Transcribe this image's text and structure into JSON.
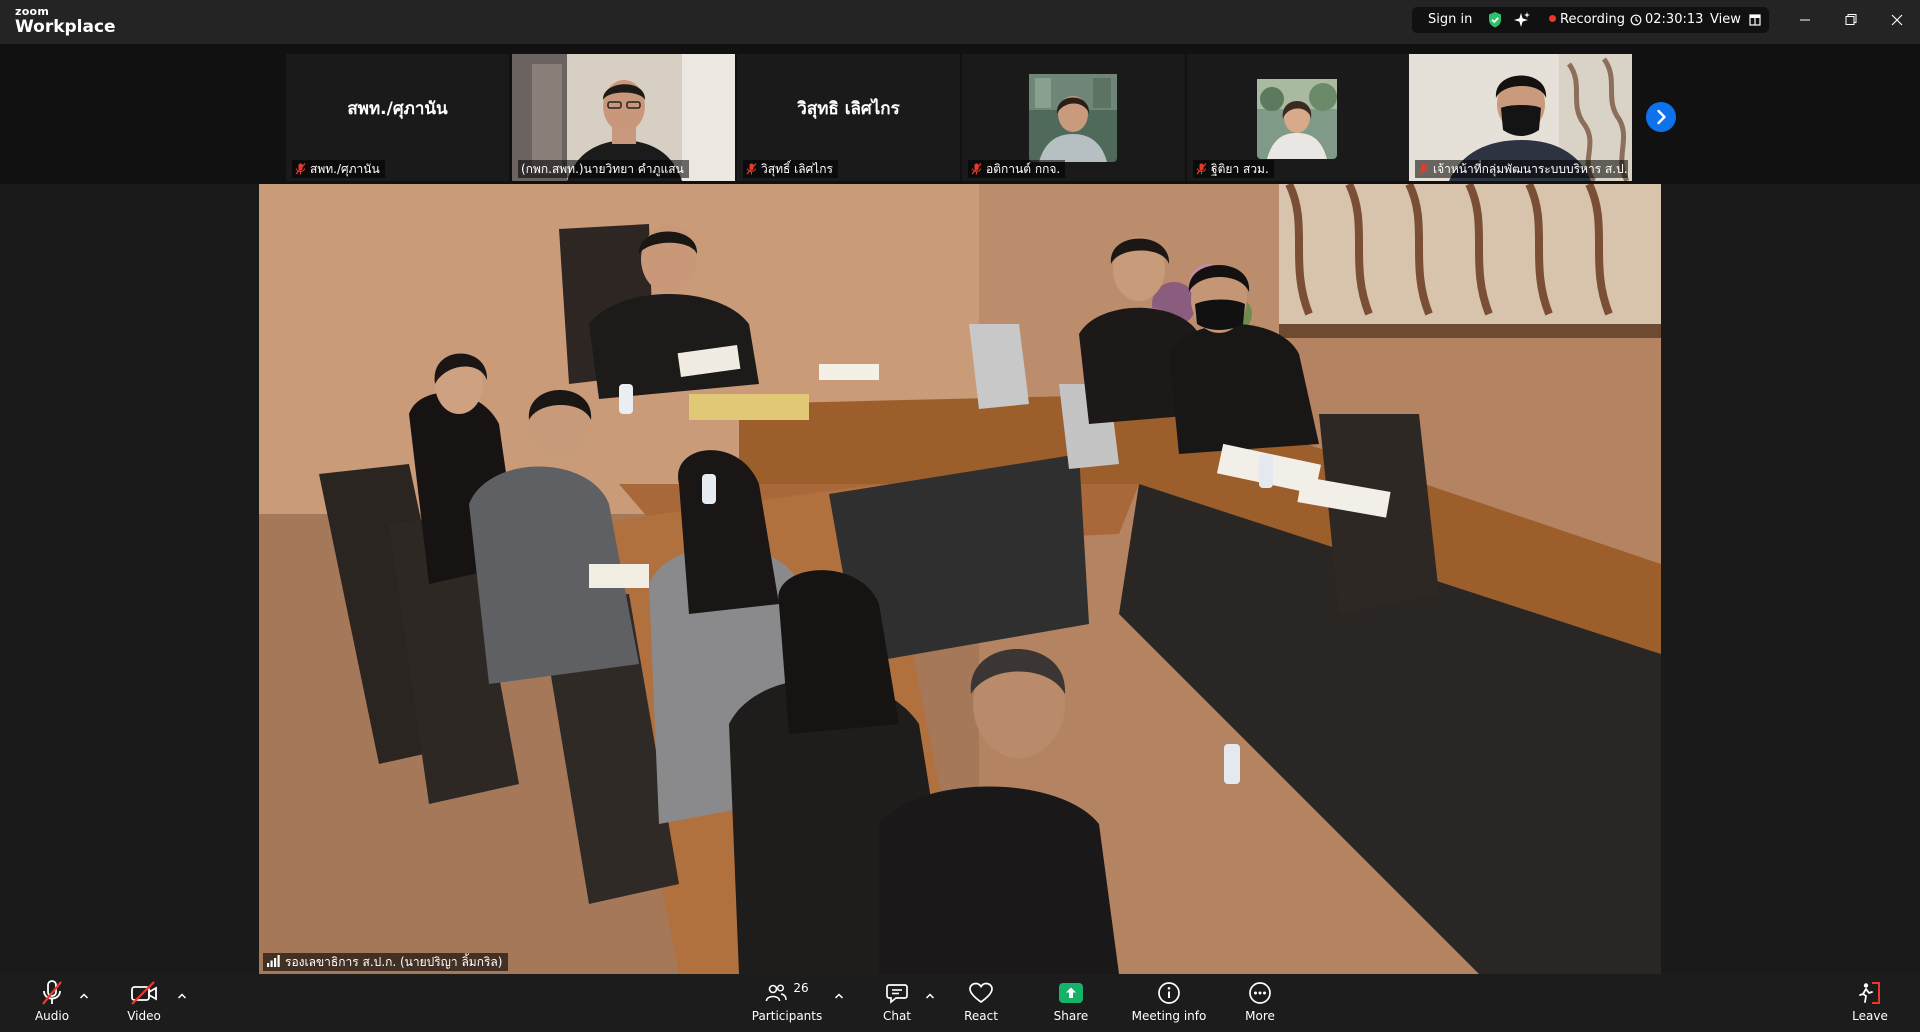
{
  "app": {
    "brand_top": "zoom",
    "brand_bottom": "Workplace"
  },
  "titlebar": {
    "sign_in": "Sign in",
    "recording": "Recording",
    "timer": "02:30:13",
    "view": "View"
  },
  "filmstrip": {
    "tiles": [
      {
        "display_name": "สพท./ศุภานัน",
        "label": "สพท./ศุภานัน",
        "muted": true,
        "has_video": false
      },
      {
        "display_name": "",
        "label": "(กพก.สพท.)นายวิทยา คำภูแสน",
        "muted": false,
        "has_video": true
      },
      {
        "display_name": "วิสุทธิ เลิศไกร",
        "label": "วิสุทธิ์ เลิศไกร",
        "muted": true,
        "has_video": false
      },
      {
        "display_name": "",
        "label": "อติกานต์ กกจ.",
        "muted": true,
        "has_video": false
      },
      {
        "display_name": "",
        "label": "ฐิติยา สวม.",
        "muted": true,
        "has_video": false
      },
      {
        "display_name": "",
        "label": "เจ้าหน้าที่กลุ่มพัฒนาระบบบริหาร ส.ป.ก...",
        "muted": true,
        "has_video": true
      }
    ]
  },
  "main_video": {
    "speaker_label": "รองเลขาธิการ ส.ป.ก. (นายปริญา ลิ้มกริล)"
  },
  "toolbar": {
    "audio": "Audio",
    "video": "Video",
    "participants": "Participants",
    "participants_count": "26",
    "chat": "Chat",
    "react": "React",
    "share": "Share",
    "meeting_info": "Meeting info",
    "more": "More",
    "leave": "Leave"
  },
  "colors": {
    "accent": "#0e72ed",
    "share": "#17b26a",
    "muted": "#e8392d",
    "recording": "#e8392d",
    "shield": "#2bc26b"
  }
}
